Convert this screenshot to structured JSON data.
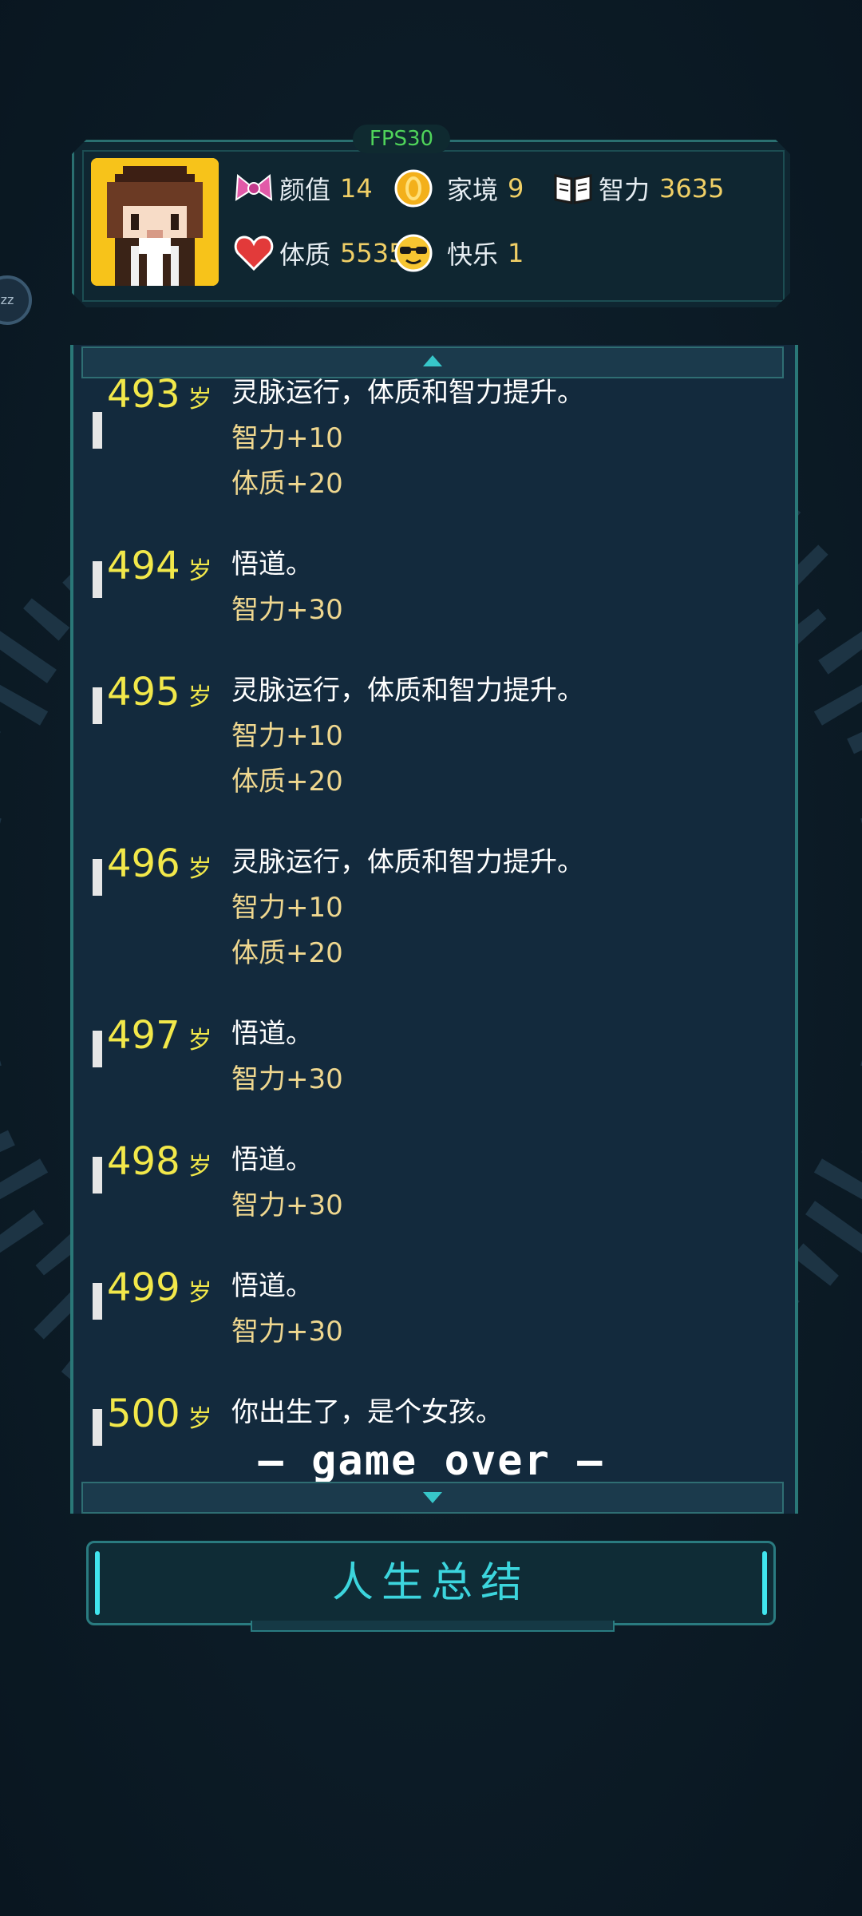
{
  "fps_label": "FPS30",
  "floating_bubble": "zz",
  "stats": {
    "looks": {
      "label": "颜值",
      "value": "14",
      "icon": "ribbon-icon"
    },
    "family": {
      "label": "家境",
      "value": "9",
      "icon": "coin-icon"
    },
    "intelligence": {
      "label": "智力",
      "value": "3635",
      "icon": "book-icon"
    },
    "constitution": {
      "label": "体质",
      "value": "5535",
      "icon": "heart-icon"
    },
    "happiness": {
      "label": "快乐",
      "value": "1",
      "icon": "sunglasses-face-icon"
    }
  },
  "age_unit": "岁",
  "log": [
    {
      "age": "493",
      "lines": [
        "灵脉运行，体质和智力提升。",
        "智力+10",
        "体质+20"
      ]
    },
    {
      "age": "494",
      "lines": [
        "悟道。",
        "智力+30"
      ]
    },
    {
      "age": "495",
      "lines": [
        "灵脉运行，体质和智力提升。",
        "智力+10",
        "体质+20"
      ]
    },
    {
      "age": "496",
      "lines": [
        "灵脉运行，体质和智力提升。",
        "智力+10",
        "体质+20"
      ]
    },
    {
      "age": "497",
      "lines": [
        "悟道。",
        "智力+30"
      ]
    },
    {
      "age": "498",
      "lines": [
        "悟道。",
        "智力+30"
      ]
    },
    {
      "age": "499",
      "lines": [
        "悟道。",
        "智力+30"
      ]
    },
    {
      "age": "500",
      "lines": [
        "你出生了，是个女孩。"
      ]
    }
  ],
  "game_over": "— game over —",
  "summary_button": "人生总结",
  "colors": {
    "age": "#f2e84a",
    "effect": "#efd78f",
    "accent": "#3cd5dd",
    "fps": "#4fd45a"
  }
}
